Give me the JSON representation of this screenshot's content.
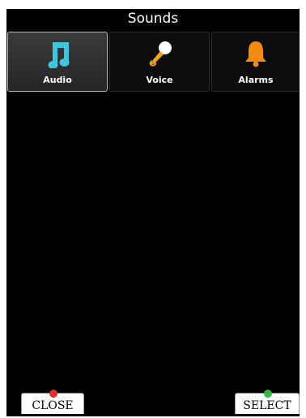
{
  "header": {
    "title": "Sounds"
  },
  "tabs": [
    {
      "label": "Audio",
      "icon": "music-note-icon",
      "selected": true
    },
    {
      "label": "Voice",
      "icon": "microphone-icon",
      "selected": false
    },
    {
      "label": "Alarms",
      "icon": "bell-icon",
      "selected": false
    }
  ],
  "footer": {
    "close_label": "CLOSE",
    "select_label": "SELECT"
  },
  "colors": {
    "audio_icon": "#3ec4dc",
    "voice_icon": "#f2a81c",
    "alarm_icon": "#f08a10",
    "close_badge": "#e0302a",
    "select_badge": "#3bb54a"
  }
}
